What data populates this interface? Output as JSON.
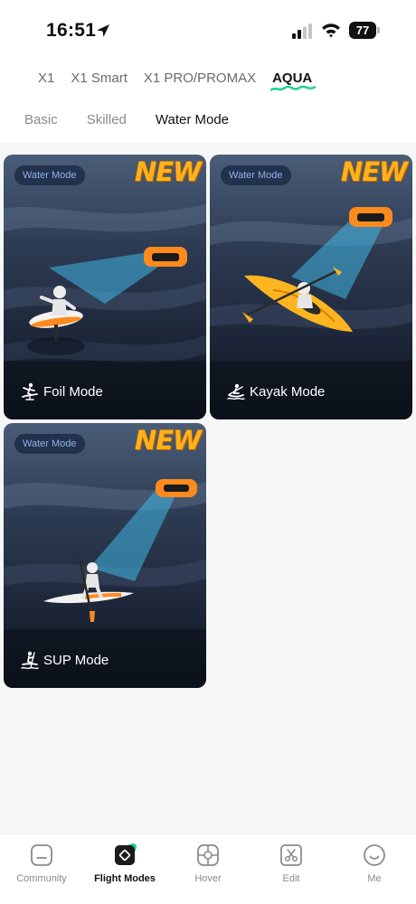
{
  "status_bar": {
    "time": "16:51",
    "battery": "77"
  },
  "product_tabs": [
    {
      "label": "X1",
      "active": false
    },
    {
      "label": "X1 Smart",
      "active": false
    },
    {
      "label": "X1 PRO/PROMAX",
      "active": false
    },
    {
      "label": "AQUA",
      "active": true
    }
  ],
  "mode_tabs": [
    {
      "label": "Basic",
      "active": false
    },
    {
      "label": "Skilled",
      "active": false
    },
    {
      "label": "Water Mode",
      "active": true
    }
  ],
  "cards": [
    {
      "badge": "Water Mode",
      "tag": "NEW",
      "label": "Foil Mode",
      "icon": "foil-surfer-icon"
    },
    {
      "badge": "Water Mode",
      "tag": "NEW",
      "label": "Kayak Mode",
      "icon": "kayak-icon"
    },
    {
      "badge": "Water Mode",
      "tag": "NEW",
      "label": "SUP Mode",
      "icon": "paddleboard-icon"
    }
  ],
  "bottom_nav": [
    {
      "label": "Community",
      "icon": "community-icon",
      "active": false
    },
    {
      "label": "Flight Modes",
      "icon": "flight-modes-icon",
      "active": true
    },
    {
      "label": "Hover",
      "icon": "hover-icon",
      "active": false
    },
    {
      "label": "Edit",
      "icon": "edit-icon",
      "active": false
    },
    {
      "label": "Me",
      "icon": "me-icon",
      "active": false
    }
  ],
  "colors": {
    "accent_green": "#1fd38a",
    "new_orange": "#ffb21a",
    "badge_text": "#8fb2e6",
    "drone_orange": "#ff8a1c"
  }
}
